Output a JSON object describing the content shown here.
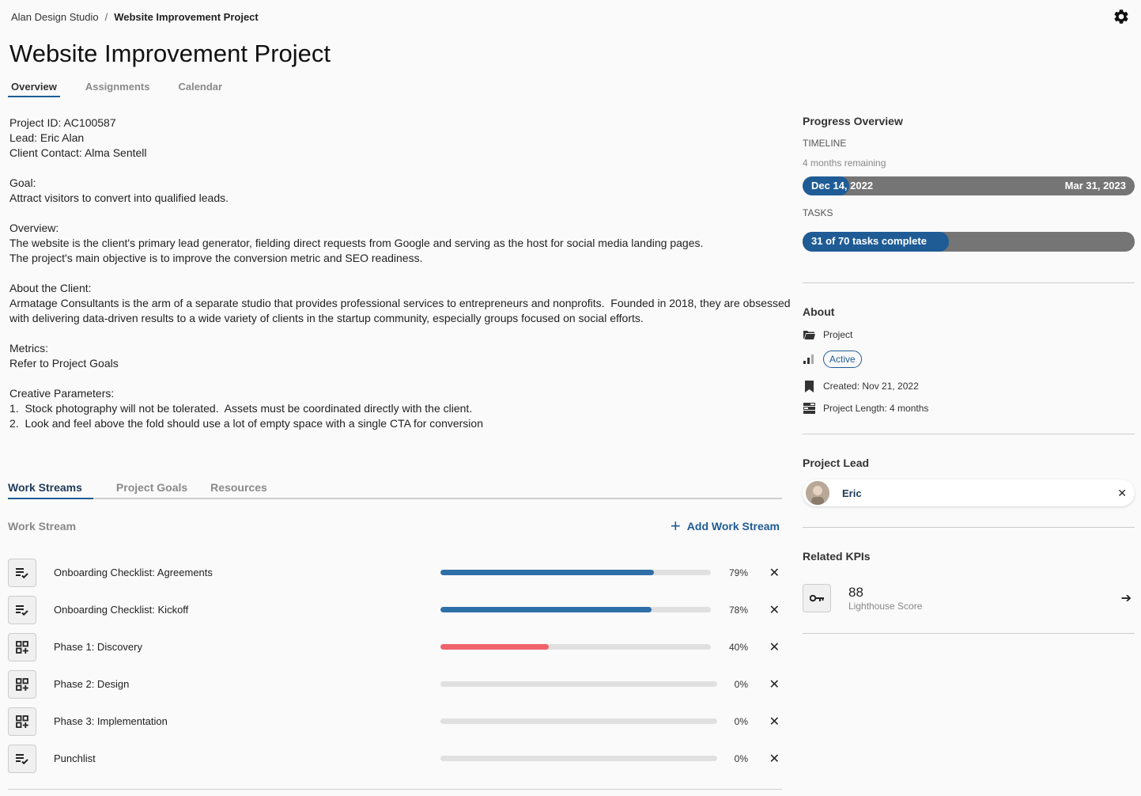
{
  "breadcrumb": {
    "root": "Alan Design Studio",
    "separator": "/",
    "current": "Website Improvement Project"
  },
  "title": "Website Improvement Project",
  "tabs": [
    {
      "label": "Overview",
      "active": true
    },
    {
      "label": "Assignments",
      "active": false
    },
    {
      "label": "Calendar",
      "active": false
    }
  ],
  "description": "Project ID: AC100587\nLead: Eric Alan\nClient Contact: Alma Sentell\n\nGoal:\nAttract visitors to convert into qualified leads.\n\nOverview:\nThe website is the client's primary lead generator, fielding direct requests from Google and serving as the host for social media landing pages.\nThe project's main objective is to improve the conversion metric and SEO readiness.\n\nAbout the Client:\nArmatage Consultants is the arm of a separate studio that provides professional services to entrepreneurs and nonprofits.  Founded in 2018, they are obsessed with delivering data-driven results to a wide variety of clients in the startup community, especially groups focused on social efforts.\n\nMetrics:\nRefer to Project Goals\n\nCreative Parameters:\n1.  Stock photography will not be tolerated.  Assets must be coordinated directly with the client.\n2.  Look and feel above the fold should use a lot of empty space with a single CTA for conversion",
  "workstream_tabs": [
    {
      "label": "Work Streams",
      "active": true
    },
    {
      "label": "Project Goals",
      "active": false
    },
    {
      "label": "Resources",
      "active": false
    }
  ],
  "workstreams": {
    "header_label": "Work Stream",
    "add_label": "Add Work Stream",
    "items": [
      {
        "name": "Onboarding Checklist: Agreements",
        "icon": "checklist-icon",
        "progress": 0.79,
        "pct": "79%",
        "color": "#2f6fa8"
      },
      {
        "name": "Onboarding Checklist: Kickoff",
        "icon": "checklist-icon",
        "progress": 0.78,
        "pct": "78%",
        "color": "#2f6fa8"
      },
      {
        "name": "Phase 1: Discovery",
        "icon": "grid-add-icon",
        "progress": 0.4,
        "pct": "40%",
        "color": "#f0636b"
      },
      {
        "name": "Phase 2: Design",
        "icon": "grid-add-icon",
        "progress": 0,
        "pct": "0%",
        "color": "#2f6fa8"
      },
      {
        "name": "Phase 3: Implementation",
        "icon": "grid-add-icon",
        "progress": 0,
        "pct": "0%",
        "color": "#2f6fa8"
      },
      {
        "name": "Punchlist",
        "icon": "checklist-icon",
        "progress": 0,
        "pct": "0%",
        "color": "#2f6fa8"
      }
    ]
  },
  "progress": {
    "title": "Progress Overview",
    "timeline_label": "TIMELINE",
    "timeline_remaining": "4 months remaining",
    "start_date": "Dec 14, 2022",
    "end_date": "Mar 31, 2023",
    "timeline_progress": 0.14,
    "tasks_label": "TASKS",
    "tasks_text": "31 of 70 tasks complete",
    "tasks_progress": 0.44
  },
  "about": {
    "title": "About",
    "type": "Project",
    "status": "Active",
    "created": "Created: Nov 21, 2022",
    "length": "Project Length: 4 months"
  },
  "lead": {
    "title": "Project Lead",
    "name": "Eric"
  },
  "kpis": {
    "title": "Related KPIs",
    "items": [
      {
        "value": "88",
        "label": "Lighthouse Score",
        "icon": "key-icon"
      }
    ]
  },
  "colors": {
    "accent": "#1f5c96",
    "danger": "#f0636b",
    "track": "#e0e0e0",
    "timeline_bg": "#757575"
  }
}
